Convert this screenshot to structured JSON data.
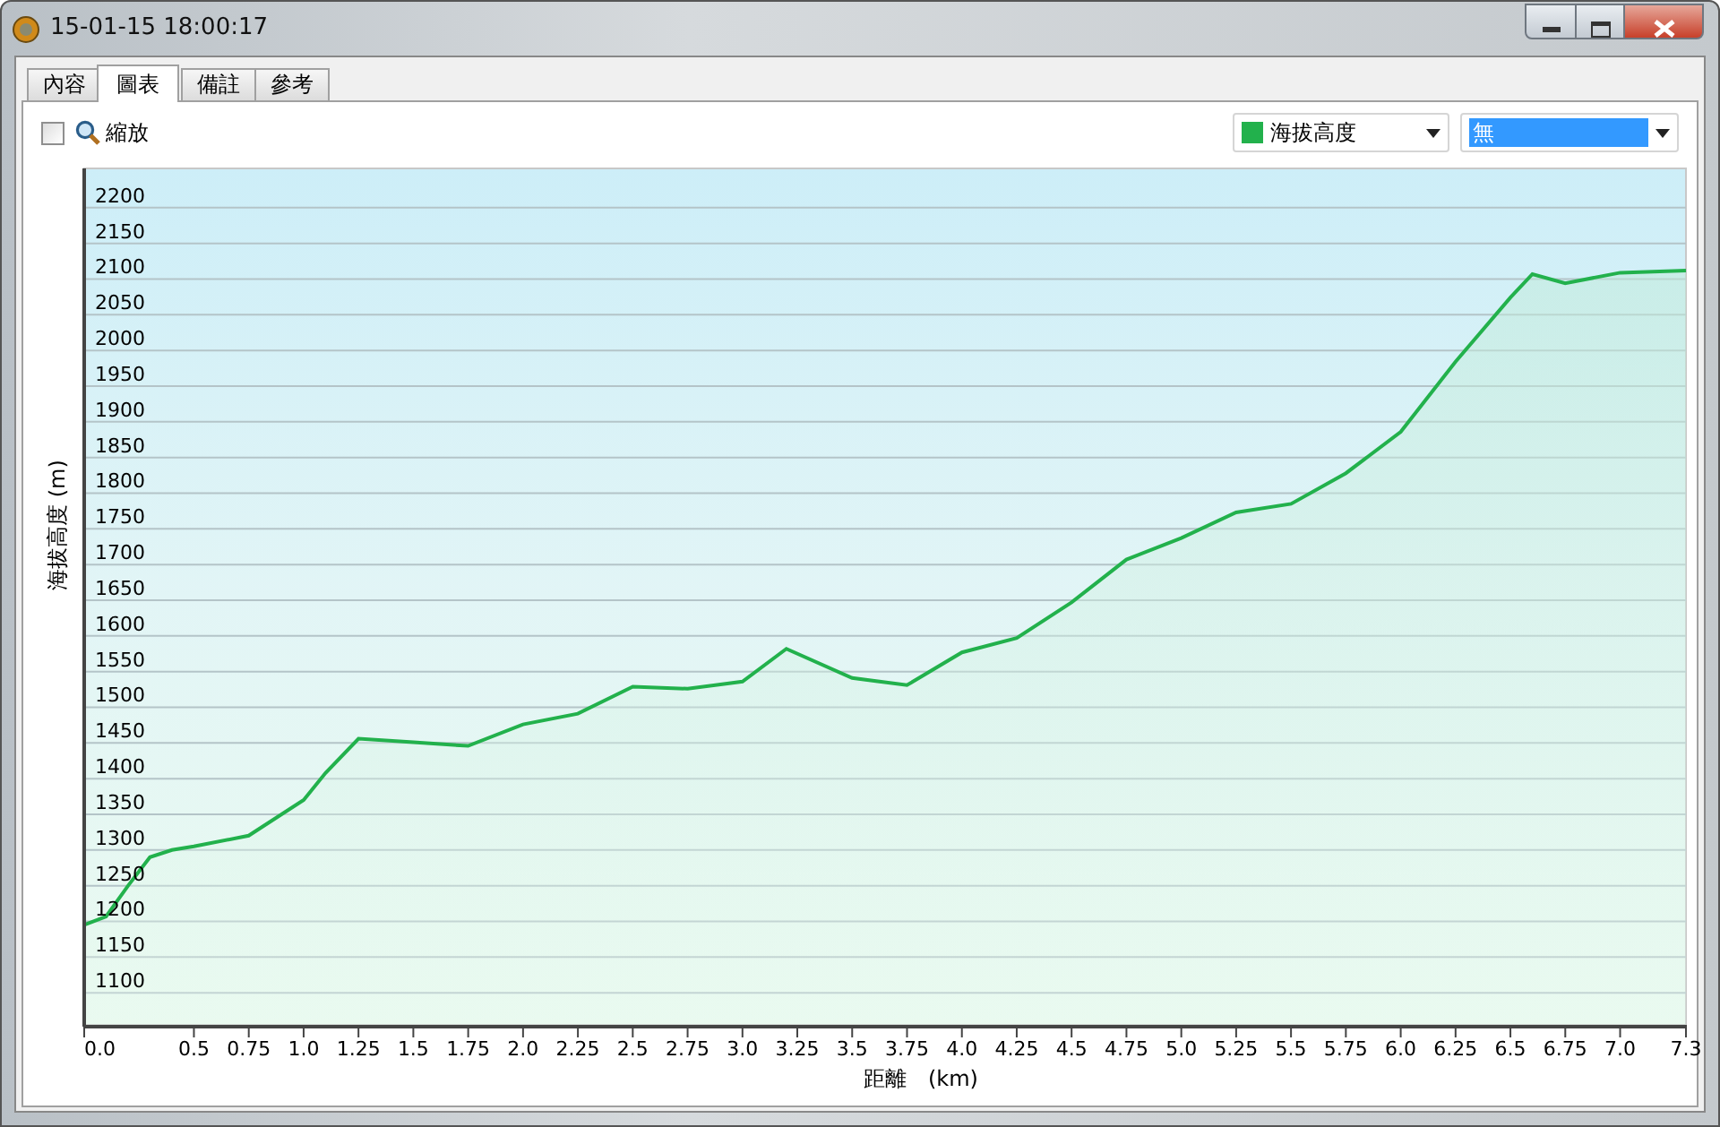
{
  "window": {
    "title": "15-01-15 18:00:17"
  },
  "tabs": [
    {
      "label": "內容",
      "selected": false
    },
    {
      "label": "圖表",
      "selected": true
    },
    {
      "label": "備註",
      "selected": false
    },
    {
      "label": "參考",
      "selected": false
    }
  ],
  "zoom": {
    "label": "縮放",
    "checked": false
  },
  "second_series": {
    "value": "無",
    "selected": true
  },
  "chart_data": {
    "type": "area",
    "grid": true,
    "xlabel": "距離　(km)",
    "ylabel": "海拔高度 (m)",
    "xlim": [
      0,
      7.3
    ],
    "ylim": [
      1055,
      2255
    ],
    "x": [
      0,
      0.1,
      0.2,
      0.3,
      0.4,
      0.5,
      0.75,
      1.0,
      1.1,
      1.25,
      1.5,
      1.75,
      2.0,
      2.25,
      2.5,
      2.75,
      3.0,
      3.2,
      3.5,
      3.75,
      4.0,
      4.25,
      4.5,
      4.75,
      5.0,
      5.25,
      5.5,
      5.75,
      6.0,
      6.25,
      6.5,
      6.6,
      6.75,
      7.0,
      7.3
    ],
    "series": [
      {
        "name": "海拔高度",
        "color": "#22b14c",
        "values": [
          1195,
          1207,
          1250,
          1290,
          1300,
          1305,
          1320,
          1370,
          1408,
          1456,
          1451,
          1446,
          1476,
          1491,
          1529,
          1526,
          1536,
          1582,
          1541,
          1531,
          1577,
          1597,
          1647,
          1707,
          1737,
          1773,
          1785,
          1828,
          1886,
          1984,
          2074,
          2107,
          2094,
          2109,
          2112
        ]
      }
    ],
    "xticks": [
      {
        "value": 0,
        "label": "0.0"
      },
      0.5,
      0.75,
      {
        "value": 1,
        "label": "1.0"
      },
      1.25,
      1.5,
      1.75,
      {
        "value": 2,
        "label": "2.0"
      },
      2.25,
      2.5,
      2.75,
      {
        "value": 3,
        "label": "3.0"
      },
      3.25,
      3.5,
      3.75,
      {
        "value": 4,
        "label": "4.0"
      },
      4.25,
      4.5,
      4.75,
      {
        "value": 5,
        "label": "5.0"
      },
      5.25,
      5.5,
      5.75,
      {
        "value": 6,
        "label": "6.0"
      },
      6.25,
      6.5,
      6.75,
      {
        "value": 7,
        "label": "7.0"
      },
      7.3
    ],
    "yticks": [
      1100,
      1150,
      1200,
      1250,
      1300,
      1350,
      1400,
      1450,
      1500,
      1550,
      1600,
      1650,
      1700,
      1750,
      1800,
      1850,
      1900,
      1950,
      2000,
      2050,
      2100,
      2150,
      2200
    ]
  }
}
